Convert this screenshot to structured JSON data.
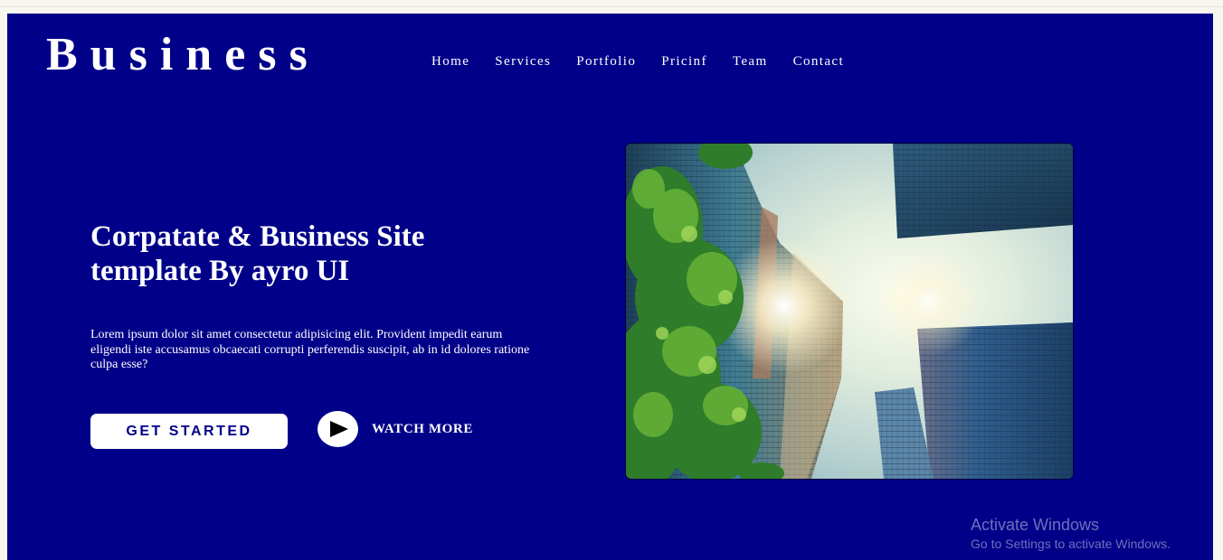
{
  "brand": {
    "logo_text": "Business"
  },
  "nav": {
    "items": [
      {
        "label": "Home"
      },
      {
        "label": "Services"
      },
      {
        "label": "Portfolio"
      },
      {
        "label": "Pricinf"
      },
      {
        "label": "Team"
      },
      {
        "label": "Contact"
      }
    ]
  },
  "hero": {
    "title": "Corpatate & Business Site template By ayro UI",
    "description": "Lorem ipsum dolor sit amet consectetur adipisicing elit. Provident impedit earum eligendi iste accusamus obcaecati corrupti perferendis suscipit, ab in id dolores ratione culpa esse?",
    "cta_label": "GET STARTED",
    "watch_label": "WATCH MORE",
    "play_icon": "play-icon",
    "image_subject": "skyscrapers-from-below-photo"
  },
  "os_overlay": {
    "activate_title": "Activate Windows",
    "activate_subtitle": "Go to Settings to activate Windows."
  },
  "colors": {
    "page_background": "#010089",
    "button_background": "#ffffff",
    "button_text": "#010089",
    "text": "#ffffff"
  }
}
